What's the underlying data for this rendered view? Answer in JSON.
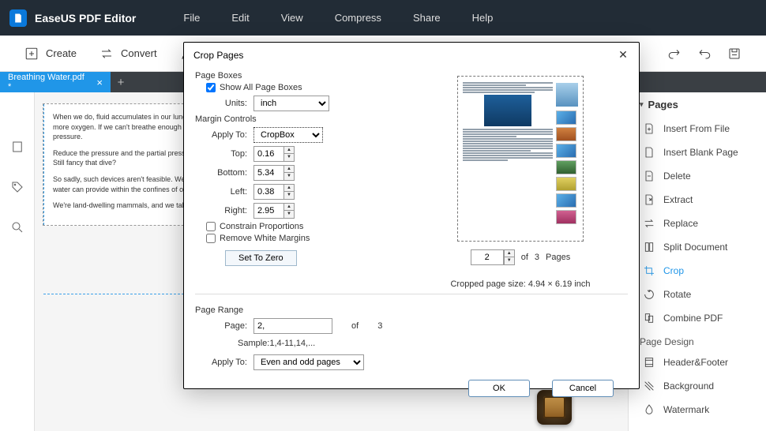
{
  "app": {
    "title": "EaseUS PDF Editor"
  },
  "menu": [
    "File",
    "Edit",
    "View",
    "Compress",
    "Share",
    "Help"
  ],
  "toolbar": {
    "create": "Create",
    "convert": "Convert"
  },
  "tab": {
    "name": "Breathing Water.pdf *"
  },
  "doc": {
    "p1": "When we do, fluid accumulates in our lungs, their alveoli's efficiency is reduced. This means we must breathe in more oxygen. If we can't breathe enough oxygen, we can develop hypoxia even at 100% oxygen at a normal pressure.",
    "p2": "Reduce the pressure and the partial pressure results could be even worse: unconsciousness and convulsions... Still fancy that dive?",
    "p3": "So sadly, such devices aren't feasible. We can't improve, but we can't extract more. We need more oxygen than water can provide within the confines of our own biochemistry.",
    "p4": "We're land-dwelling mammals, and we take the air we breathe with us."
  },
  "right_panel": {
    "header": "Pages",
    "items": [
      "Insert From File",
      "Insert Blank Page",
      "Delete",
      "Extract",
      "Replace",
      "Split Document",
      "Crop",
      "Rotate",
      "Combine PDF"
    ],
    "section2": "Page Design",
    "items2": [
      "Header&Footer",
      "Background",
      "Watermark"
    ]
  },
  "dialog": {
    "title": "Crop Pages",
    "page_boxes_label": "Page Boxes",
    "show_all": "Show All Page Boxes",
    "units_label": "Units:",
    "units_value": "inch",
    "margin_controls": "Margin Controls",
    "apply_to_label": "Apply To:",
    "apply_to_value": "CropBox",
    "top_label": "Top:",
    "top_value": "0.16",
    "bottom_label": "Bottom:",
    "bottom_value": "5.34",
    "left_label": "Left:",
    "left_value": "0.38",
    "right_label": "Right:",
    "right_value": "2.95",
    "constrain": "Constrain Proportions",
    "remove_white": "Remove White Margins",
    "set_zero": "Set To Zero",
    "page_range": "Page Range",
    "page_label": "Page:",
    "page_value": "2,",
    "page_of": "of",
    "page_total": "3",
    "sample": "Sample:1,4-11,14,...",
    "apply_to2": "Apply To:",
    "apply_to2_value": "Even and odd pages",
    "preview_page": "2",
    "preview_of": "of",
    "preview_total": "3",
    "preview_pages_label": "Pages",
    "cropped_size": "Cropped page size: 4.94 × 6.19 inch",
    "ok": "OK",
    "cancel": "Cancel"
  }
}
